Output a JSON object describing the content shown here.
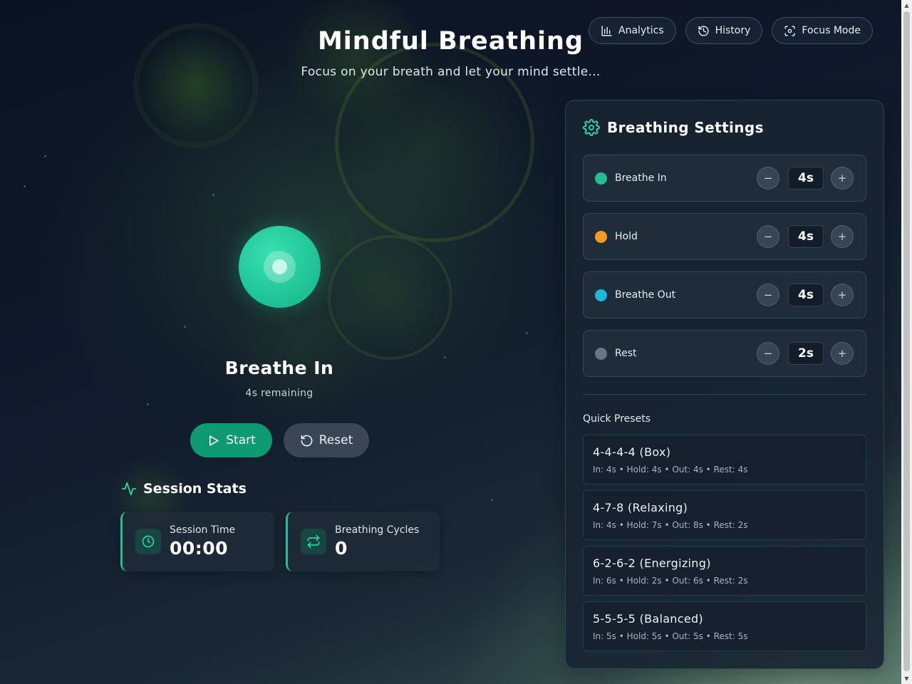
{
  "header": {
    "title": "Mindful Breathing",
    "subtitle": "Focus on your breath and let your mind settle..."
  },
  "nav": {
    "analytics": "Analytics",
    "history": "History",
    "focus_mode": "Focus Mode"
  },
  "breath": {
    "phase": "Breathe In",
    "remaining": "4s remaining"
  },
  "controls": {
    "start": "Start",
    "reset": "Reset"
  },
  "stats": {
    "heading": "Session Stats",
    "session_time_label": "Session Time",
    "session_time_value": "00:00",
    "cycles_label": "Breathing Cycles",
    "cycles_value": "0"
  },
  "settings": {
    "title": "Breathing Settings",
    "rows": [
      {
        "label": "Breathe In",
        "value": "4s",
        "color": "#1fbf93"
      },
      {
        "label": "Hold",
        "value": "4s",
        "color": "#f59a23"
      },
      {
        "label": "Breathe Out",
        "value": "4s",
        "color": "#1fb6d3"
      },
      {
        "label": "Rest",
        "value": "2s",
        "color": "#6b7680"
      }
    ],
    "minus": "−",
    "plus": "+"
  },
  "presets": {
    "label": "Quick Presets",
    "items": [
      {
        "name": "4-4-4-4 (Box)",
        "desc": "In: 4s • Hold: 4s • Out: 4s • Rest: 4s"
      },
      {
        "name": "4-7-8 (Relaxing)",
        "desc": "In: 4s • Hold: 7s • Out: 8s • Rest: 2s"
      },
      {
        "name": "6-2-6-2 (Energizing)",
        "desc": "In: 6s • Hold: 2s • Out: 6s • Rest: 2s"
      },
      {
        "name": "5-5-5-5 (Balanced)",
        "desc": "In: 5s • Hold: 5s • Out: 5s • Rest: 5s"
      }
    ]
  },
  "colors": {
    "accent": "#1fbf93",
    "start_button": "#0f9a72"
  }
}
